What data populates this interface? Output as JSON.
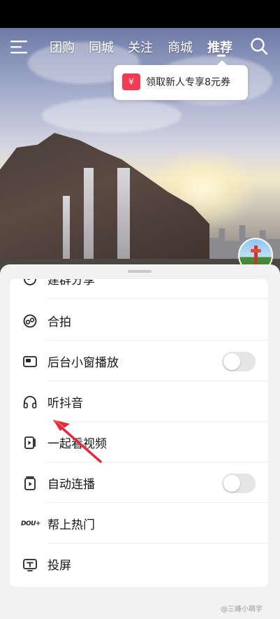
{
  "top_nav": {
    "tabs": [
      {
        "label": "团购"
      },
      {
        "label": "同城"
      },
      {
        "label": "关注"
      },
      {
        "label": "商城"
      },
      {
        "label": "推荐",
        "active": true
      }
    ]
  },
  "coupon": {
    "icon_text": "¥",
    "text": "领取新人专享8元券"
  },
  "menu": {
    "partial_top_label": "建群分享",
    "items": [
      {
        "label": "合拍",
        "icon": "duet-icon"
      },
      {
        "label": "后台小窗播放",
        "icon": "mini-window-icon",
        "toggle": false
      },
      {
        "label": "听抖音",
        "icon": "headphones-icon"
      },
      {
        "label": "一起看视频",
        "icon": "watch-together-icon"
      },
      {
        "label": "自动连播",
        "icon": "autoplay-icon",
        "toggle": false
      },
      {
        "label": "帮上热门",
        "icon": "dou-plus-icon",
        "icon_text": "DOU+"
      },
      {
        "label": "投屏",
        "icon": "cast-tv-icon"
      }
    ]
  },
  "watermark": {
    "text": "@三峰小萌宇"
  },
  "colors": {
    "coupon_red": "#f23a55",
    "annotation_arrow": "#e8283a",
    "toggle_off": "#e5e5e5"
  }
}
